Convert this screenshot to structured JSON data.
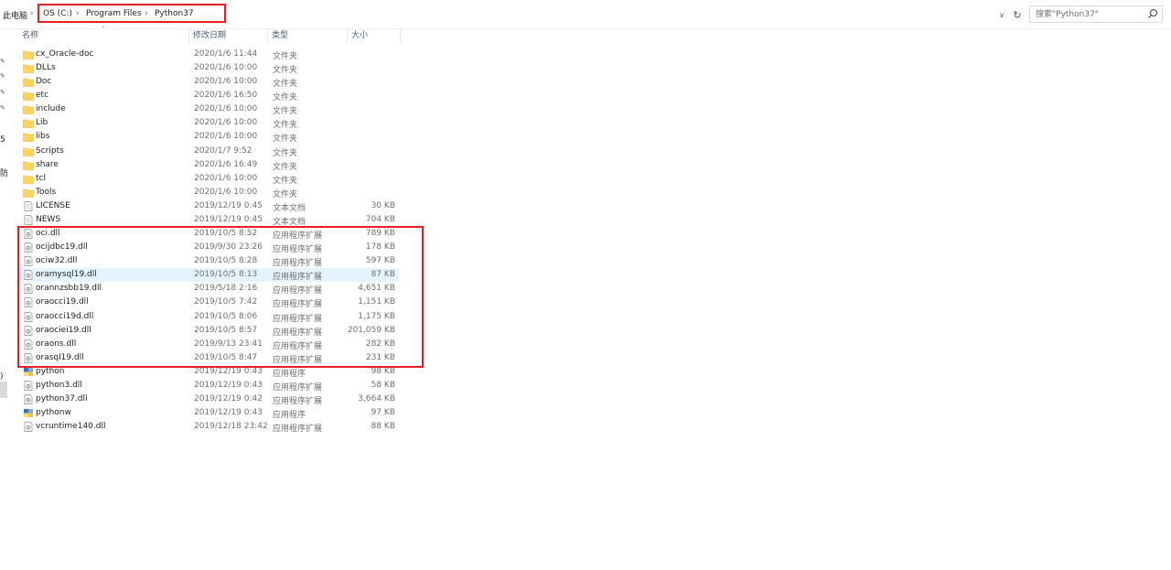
{
  "address": {
    "root": "此电脑",
    "crumbs": [
      "OS (C:)",
      "Program Files",
      "Python37"
    ]
  },
  "search": {
    "placeholder": "搜索\"Python37\""
  },
  "nav_fragments": [
    "5",
    "防",
    ")"
  ],
  "columns": {
    "name": "名称",
    "date": "修改日期",
    "type": "类型",
    "size": "大小"
  },
  "files": [
    {
      "icon": "folder",
      "name": "cx_Oracle-doc",
      "date": "2020/1/6 11:44",
      "type": "文件夹",
      "size": ""
    },
    {
      "icon": "folder",
      "name": "DLLs",
      "date": "2020/1/6 10:00",
      "type": "文件夹",
      "size": ""
    },
    {
      "icon": "folder",
      "name": "Doc",
      "date": "2020/1/6 10:00",
      "type": "文件夹",
      "size": ""
    },
    {
      "icon": "folder",
      "name": "etc",
      "date": "2020/1/6 16:50",
      "type": "文件夹",
      "size": ""
    },
    {
      "icon": "folder",
      "name": "include",
      "date": "2020/1/6 10:00",
      "type": "文件夹",
      "size": ""
    },
    {
      "icon": "folder",
      "name": "Lib",
      "date": "2020/1/6 10:00",
      "type": "文件夹",
      "size": ""
    },
    {
      "icon": "folder",
      "name": "libs",
      "date": "2020/1/6 10:00",
      "type": "文件夹",
      "size": ""
    },
    {
      "icon": "folder",
      "name": "Scripts",
      "date": "2020/1/7 9:52",
      "type": "文件夹",
      "size": ""
    },
    {
      "icon": "folder",
      "name": "share",
      "date": "2020/1/6 16:49",
      "type": "文件夹",
      "size": ""
    },
    {
      "icon": "folder",
      "name": "tcl",
      "date": "2020/1/6 10:00",
      "type": "文件夹",
      "size": ""
    },
    {
      "icon": "folder",
      "name": "Tools",
      "date": "2020/1/6 10:00",
      "type": "文件夹",
      "size": ""
    },
    {
      "icon": "doc",
      "name": "LICENSE",
      "date": "2019/12/19 0:45",
      "type": "文本文档",
      "size": "30 KB"
    },
    {
      "icon": "doc",
      "name": "NEWS",
      "date": "2019/12/19 0:45",
      "type": "文本文档",
      "size": "704 KB"
    },
    {
      "icon": "dll",
      "name": "oci.dll",
      "date": "2019/10/5 8:52",
      "type": "应用程序扩展",
      "size": "789 KB"
    },
    {
      "icon": "dll",
      "name": "ocijdbc19.dll",
      "date": "2019/9/30 23:26",
      "type": "应用程序扩展",
      "size": "178 KB"
    },
    {
      "icon": "dll",
      "name": "ociw32.dll",
      "date": "2019/10/5 8:28",
      "type": "应用程序扩展",
      "size": "597 KB"
    },
    {
      "icon": "dll",
      "name": "oramysql19.dll",
      "date": "2019/10/5 8:13",
      "type": "应用程序扩展",
      "size": "87 KB"
    },
    {
      "icon": "dll",
      "name": "orannzsbb19.dll",
      "date": "2019/5/18 2:16",
      "type": "应用程序扩展",
      "size": "4,651 KB"
    },
    {
      "icon": "dll",
      "name": "oraocci19.dll",
      "date": "2019/10/5 7:42",
      "type": "应用程序扩展",
      "size": "1,151 KB"
    },
    {
      "icon": "dll",
      "name": "oraocci19d.dll",
      "date": "2019/10/5 8:06",
      "type": "应用程序扩展",
      "size": "1,175 KB"
    },
    {
      "icon": "dll",
      "name": "oraociei19.dll",
      "date": "2019/10/5 8:57",
      "type": "应用程序扩展",
      "size": "201,059 KB"
    },
    {
      "icon": "dll",
      "name": "oraons.dll",
      "date": "2019/9/13 23:41",
      "type": "应用程序扩展",
      "size": "282 KB"
    },
    {
      "icon": "dll",
      "name": "orasql19.dll",
      "date": "2019/10/5 8:47",
      "type": "应用程序扩展",
      "size": "231 KB"
    },
    {
      "icon": "exe",
      "name": "python",
      "date": "2019/12/19 0:43",
      "type": "应用程序",
      "size": "98 KB"
    },
    {
      "icon": "dll",
      "name": "python3.dll",
      "date": "2019/12/19 0:43",
      "type": "应用程序扩展",
      "size": "58 KB"
    },
    {
      "icon": "dll",
      "name": "python37.dll",
      "date": "2019/12/19 0:42",
      "type": "应用程序扩展",
      "size": "3,664 KB"
    },
    {
      "icon": "exe",
      "name": "pythonw",
      "date": "2019/12/19 0:43",
      "type": "应用程序",
      "size": "97 KB"
    },
    {
      "icon": "dll",
      "name": "vcruntime140.dll",
      "date": "2019/12/18 23:42",
      "type": "应用程序扩展",
      "size": "88 KB"
    }
  ],
  "highlighted_file": "oramysql19.dll",
  "colors": {
    "annotation": "#e81e25",
    "folder": "#ffd35c",
    "hover": "#e5f3ff"
  }
}
